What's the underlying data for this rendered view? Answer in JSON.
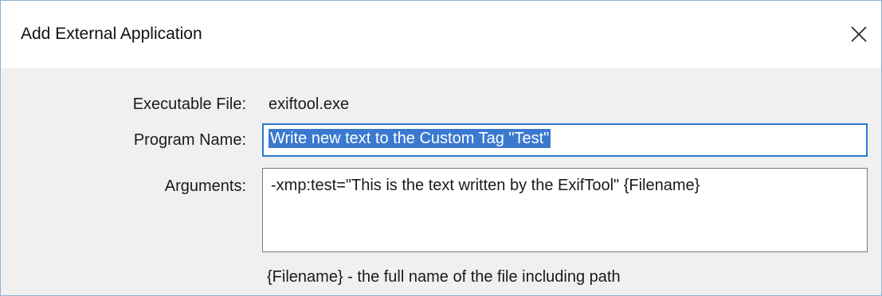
{
  "window": {
    "title": "Add External Application",
    "close_icon": "close-icon"
  },
  "form": {
    "executable_label": "Executable File:",
    "executable_value": "exiftool.exe",
    "program_name_label": "Program Name:",
    "program_name_value": "Write new text to the Custom Tag \"Test\"",
    "arguments_label": "Arguments:",
    "arguments_value": "-xmp:test=\"This is the text written by the ExifTool\" {Filename}",
    "hint": "{Filename} - the full name of the file including path"
  },
  "colors": {
    "selection": "#3a79cf",
    "focus_border": "#2b79d1",
    "dialog_background": "#f0f0f0"
  }
}
